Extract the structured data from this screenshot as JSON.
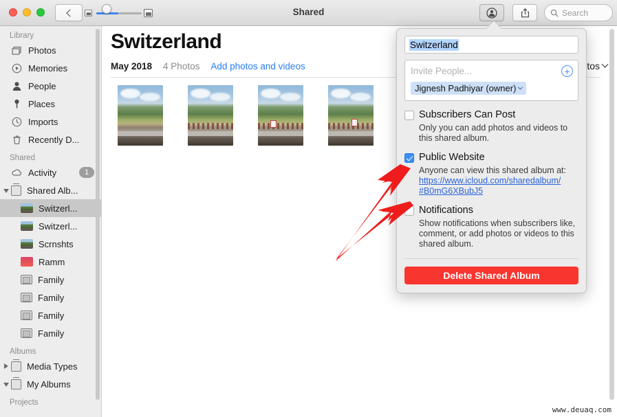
{
  "window": {
    "title": "Shared",
    "traffic_lights": [
      "close",
      "minimize",
      "zoom"
    ],
    "back_button": "back-button",
    "zoom_slider": {
      "min_icon": "small-photo-icon",
      "max_icon": "large-photo-icon",
      "value": 45
    }
  },
  "toolbar": {
    "people_button": "people-icon",
    "share_button": "share-icon",
    "search_placeholder": "Search"
  },
  "sidebar": {
    "sections": [
      {
        "title": "Library",
        "items": [
          {
            "label": "Photos",
            "icon": "photos-icon"
          },
          {
            "label": "Memories",
            "icon": "memories-icon"
          },
          {
            "label": "People",
            "icon": "people-icon"
          },
          {
            "label": "Places",
            "icon": "pin-icon"
          },
          {
            "label": "Imports",
            "icon": "clock-icon"
          },
          {
            "label": "Recently D...",
            "icon": "trash-icon"
          }
        ]
      },
      {
        "title": "Shared",
        "items": [
          {
            "label": "Activity",
            "icon": "cloud-icon",
            "badge": "1"
          },
          {
            "label": "Shared Alb...",
            "icon": "shared-albums-icon",
            "disclosure": "open"
          },
          {
            "label": "Switzerl...",
            "icon": "album-thumb",
            "indent": true,
            "selected": true
          },
          {
            "label": "Switzerl...",
            "icon": "album-thumb",
            "indent": true
          },
          {
            "label": "Scrnshts",
            "icon": "album-thumb",
            "indent": true
          },
          {
            "label": "Ramm",
            "icon": "album-thumb-red",
            "indent": true
          },
          {
            "label": "Family",
            "icon": "album-icon",
            "indent": true
          },
          {
            "label": "Family",
            "icon": "album-icon",
            "indent": true
          },
          {
            "label": "Family",
            "icon": "album-icon",
            "indent": true
          },
          {
            "label": "Family",
            "icon": "album-icon",
            "indent": true
          }
        ]
      },
      {
        "title": "Albums",
        "items": [
          {
            "label": "Media Types",
            "icon": "stack-icon",
            "disclosure": "closed"
          },
          {
            "label": "My Albums",
            "icon": "stack-icon",
            "disclosure": "open"
          }
        ]
      },
      {
        "title": "Projects",
        "items": []
      }
    ]
  },
  "main": {
    "album_title": "Switzerland",
    "date": "May 2018",
    "photo_count": "4 Photos",
    "add_link": "Add photos and videos",
    "filter_label": "tos",
    "photos": [
      {
        "alt": "swiss-landscape-1"
      },
      {
        "alt": "swiss-landscape-2"
      },
      {
        "alt": "swiss-landscape-3"
      },
      {
        "alt": "swiss-landscape-4"
      }
    ]
  },
  "popover": {
    "album_name": "Switzerland",
    "invite_placeholder": "Invite People...",
    "add_person_icon": "plus-circle-icon",
    "owner_token": "Jignesh Padhiyar (owner)",
    "subscribers": {
      "label": "Subscribers Can Post",
      "checked": false,
      "description": "Only you can add photos and videos to this shared album."
    },
    "public_website": {
      "label": "Public Website",
      "checked": true,
      "description": "Anyone can view this shared album at:",
      "url_line1": "https://www.icloud.com/sharedalbum/",
      "url_line2": "#B0mG6XBubJ5"
    },
    "notifications": {
      "label": "Notifications",
      "checked": false,
      "description": "Show notifications when subscribers like, comment, or add photos or videos to this shared album."
    },
    "delete_button": "Delete Shared Album"
  },
  "annotations": {
    "arrow_color": "#ee1c1c",
    "arrow_count": 2
  },
  "watermark": "www.deuaq.com",
  "colors": {
    "accent_blue": "#3b8ef5",
    "link_blue": "#2a63d8",
    "danger_red": "#f8352f",
    "sidebar_bg": "#ededed",
    "popover_bg": "#ececec"
  }
}
